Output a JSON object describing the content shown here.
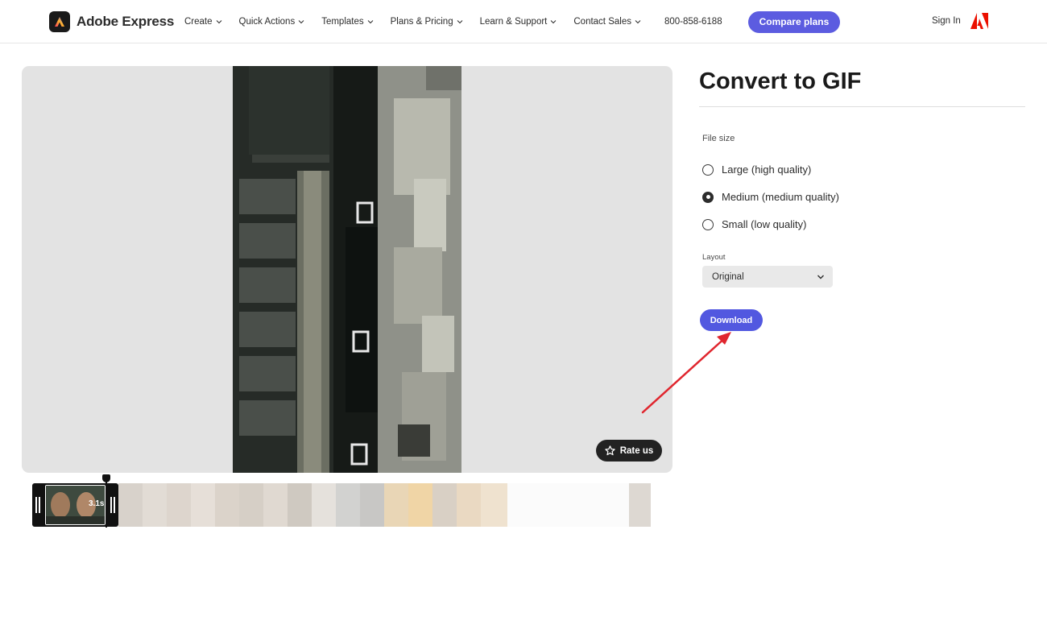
{
  "header": {
    "brand": "Adobe Express",
    "nav": [
      {
        "label": "Create"
      },
      {
        "label": "Quick Actions"
      },
      {
        "label": "Templates"
      },
      {
        "label": "Plans & Pricing"
      },
      {
        "label": "Learn & Support"
      },
      {
        "label": "Contact Sales"
      }
    ],
    "phone": "800-858-6188",
    "compare_label": "Compare plans",
    "sign_in": "Sign In"
  },
  "preview": {
    "rate_label": "Rate us"
  },
  "timeline": {
    "duration": "3.1s"
  },
  "panel": {
    "title": "Convert to GIF",
    "file_size_label": "File size",
    "options": [
      {
        "label": "Large (high quality)",
        "selected": false
      },
      {
        "label": "Medium (medium quality)",
        "selected": true
      },
      {
        "label": "Small (low quality)",
        "selected": false
      }
    ],
    "layout_label": "Layout",
    "layout_value": "Original",
    "download_label": "Download"
  },
  "colors": {
    "accent": "#5c5ce0",
    "annotation_arrow": "#e0262e"
  }
}
